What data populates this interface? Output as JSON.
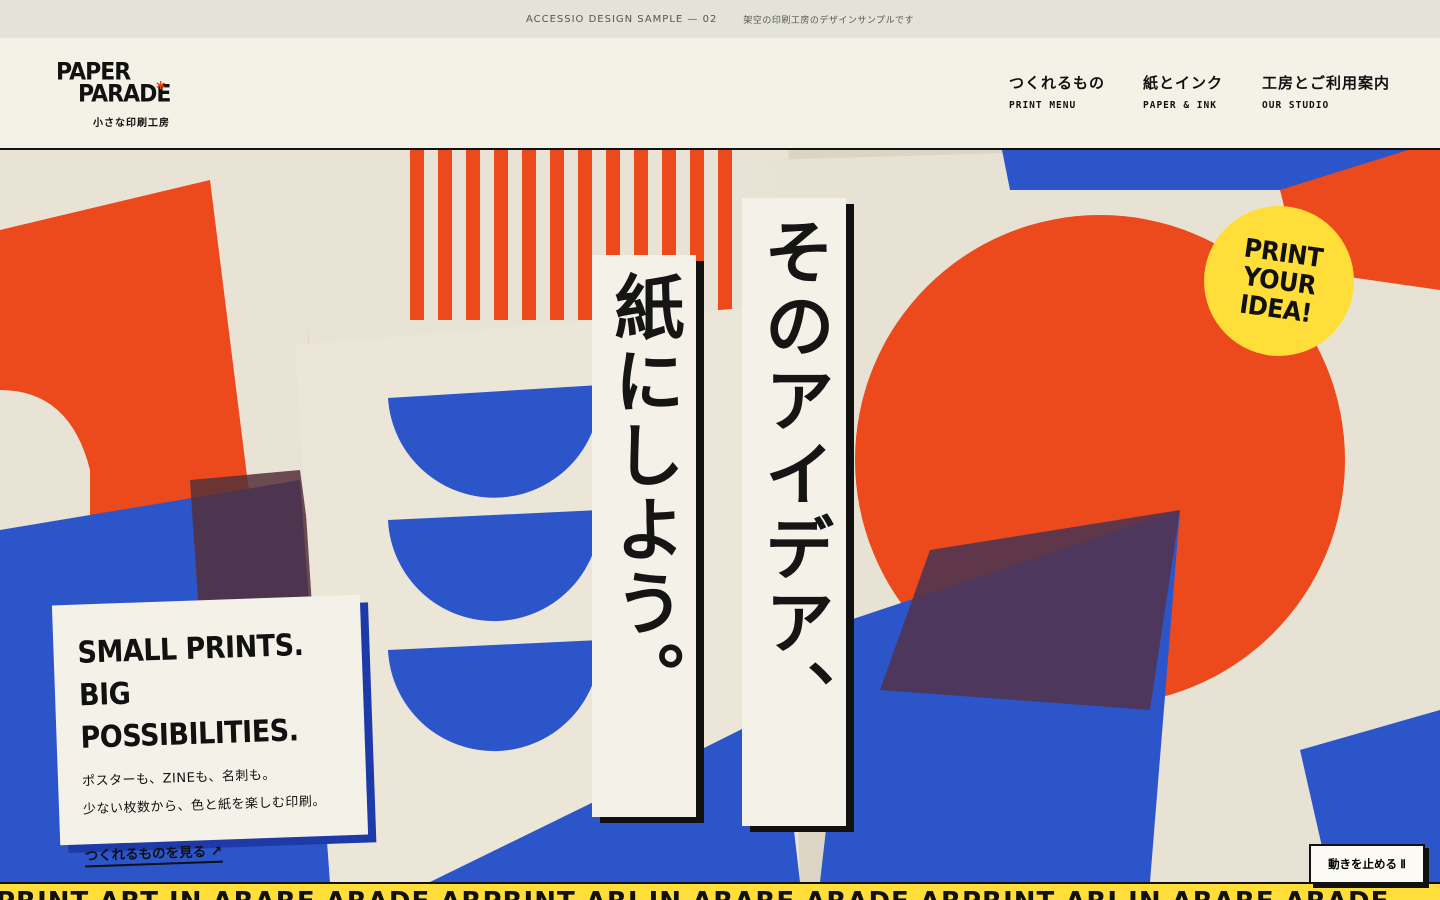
{
  "topbar": {
    "sample_label": "ACCESSIO DESIGN SAMPLE — 02",
    "note": "架空の印刷工房のデザインサンプルです"
  },
  "logo": {
    "line1": "PAPER",
    "line2": "PARADE",
    "star": "*",
    "tagline": "小さな印刷工房"
  },
  "nav": [
    {
      "jp": "つくれるもの",
      "en": "PRINT MENU"
    },
    {
      "jp": "紙とインク",
      "en": "PAPER & INK"
    },
    {
      "jp": "工房とご利用案内",
      "en": "OUR STUDIO"
    }
  ],
  "hero": {
    "headline_1": "そのアイデア、",
    "headline_2": "紙にしよう。",
    "badge": "PRINT\nYOUR\nIDEA!",
    "colors": {
      "orange": "#ec4a1c",
      "blue": "#2c55c9",
      "yellow": "#ffde3a",
      "paper": "#ece6d8"
    }
  },
  "card": {
    "heading_line1": "SMALL PRINTS.",
    "heading_line2": "BIG POSSIBILITIES.",
    "body_line1": "ポスターも、ZINEも、名刺も。",
    "body_line2": "少ない枚数から、色と紙を楽しむ印刷。",
    "link": "つくれるものを見る ↗"
  },
  "pause_button": "動きを止める Ⅱ",
  "ticker": "PRINT ART IN ARARE ARADE ARPRINT ARI IN ARARE ARADE ARPRINT ARI IN ARARE ARADE"
}
